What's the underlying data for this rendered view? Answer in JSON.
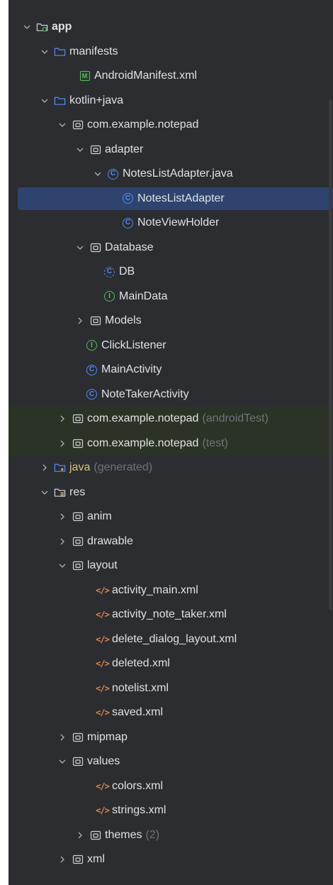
{
  "colors": {
    "panel_bg": "#2b2d30",
    "selection_bg": "#2e436e",
    "test_row_bg": "#2b3326",
    "text": "#dfe1e5",
    "muted_text": "#6f737a",
    "class_icon": "#548af7",
    "interface_icon": "#5fb865",
    "xml_icon": "#e8844a"
  },
  "tree": [
    {
      "label": "app",
      "icon": "module-folder-icon",
      "arrow": "expanded",
      "bold": true
    },
    {
      "label": "manifests",
      "icon": "folder-icon",
      "arrow": "expanded"
    },
    {
      "label": "AndroidManifest.xml",
      "icon": "manifest-icon"
    },
    {
      "label": "kotlin+java",
      "icon": "folder-icon",
      "arrow": "expanded"
    },
    {
      "label": "com.example.notepad",
      "icon": "package-icon",
      "arrow": "expanded"
    },
    {
      "label": "adapter",
      "icon": "package-icon",
      "arrow": "expanded"
    },
    {
      "label": "NotesListAdapter.java",
      "icon": "class-icon",
      "arrow": "expanded"
    },
    {
      "label": "NotesListAdapter",
      "icon": "class-icon",
      "selected": true
    },
    {
      "label": "NoteViewHolder",
      "icon": "class-icon"
    },
    {
      "label": "Database",
      "icon": "package-icon",
      "arrow": "expanded"
    },
    {
      "label": "DB",
      "icon": "abstract-class-icon"
    },
    {
      "label": "MainData",
      "icon": "interface-icon"
    },
    {
      "label": "Models",
      "icon": "package-icon",
      "arrow": "collapsed"
    },
    {
      "label": "ClickListener",
      "icon": "interface-icon"
    },
    {
      "label": "MainActivity",
      "icon": "class-icon"
    },
    {
      "label": "NoteTakerActivity",
      "icon": "class-icon"
    },
    {
      "label": "com.example.notepad",
      "suffix": "(androidTest)",
      "icon": "package-icon",
      "arrow": "collapsed",
      "test": true
    },
    {
      "label": "com.example.notepad",
      "suffix": "(test)",
      "icon": "package-icon",
      "arrow": "collapsed",
      "test": true
    },
    {
      "label": "java",
      "suffix": "(generated)",
      "icon": "generated-folder-icon",
      "arrow": "collapsed",
      "generated": true
    },
    {
      "label": "res",
      "icon": "resources-folder-icon",
      "arrow": "expanded"
    },
    {
      "label": "anim",
      "icon": "package-icon",
      "arrow": "collapsed"
    },
    {
      "label": "drawable",
      "icon": "package-icon",
      "arrow": "collapsed"
    },
    {
      "label": "layout",
      "icon": "package-icon",
      "arrow": "expanded"
    },
    {
      "label": "activity_main.xml",
      "icon": "xml-file-icon"
    },
    {
      "label": "activity_note_taker.xml",
      "icon": "xml-file-icon"
    },
    {
      "label": "delete_dialog_layout.xml",
      "icon": "xml-file-icon"
    },
    {
      "label": "deleted.xml",
      "icon": "xml-file-icon"
    },
    {
      "label": "notelist.xml",
      "icon": "xml-file-icon"
    },
    {
      "label": "saved.xml",
      "icon": "xml-file-icon"
    },
    {
      "label": "mipmap",
      "icon": "package-icon",
      "arrow": "collapsed"
    },
    {
      "label": "values",
      "icon": "package-icon",
      "arrow": "expanded"
    },
    {
      "label": "colors.xml",
      "icon": "xml-file-icon"
    },
    {
      "label": "strings.xml",
      "icon": "xml-file-icon"
    },
    {
      "label": "themes",
      "suffix": "(2)",
      "icon": "package-icon",
      "arrow": "collapsed"
    },
    {
      "label": "xml",
      "icon": "package-icon",
      "arrow": "collapsed"
    }
  ]
}
